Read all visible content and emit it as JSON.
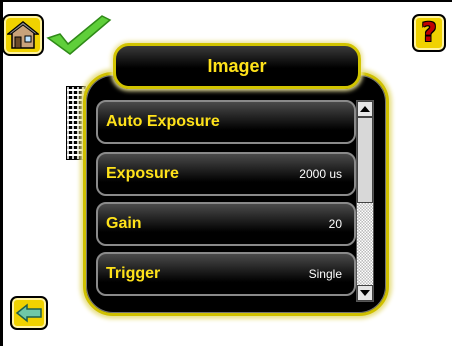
{
  "header": {
    "title": "Imager",
    "home_icon": "home-icon",
    "status_icon": "checkmark-icon",
    "help_label": "?"
  },
  "menu": {
    "items": [
      {
        "label": "Auto Exposure",
        "value": "",
        "value_dim": true
      },
      {
        "label": "Exposure",
        "value": "2000 us"
      },
      {
        "label": "Gain",
        "value": "20"
      },
      {
        "label": "Trigger",
        "value": "Single"
      }
    ]
  },
  "footer": {
    "back_icon": "back-arrow-icon"
  },
  "colors": {
    "accent": "#ffe21a",
    "button_yellow": "#f0d200",
    "status_green": "#5fcf3a",
    "help_red": "#c00000"
  }
}
